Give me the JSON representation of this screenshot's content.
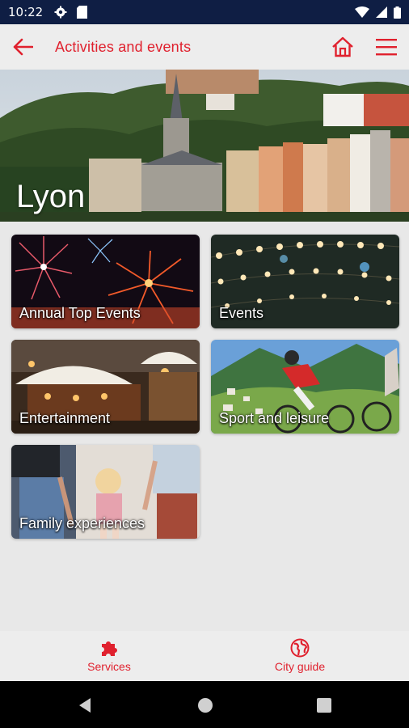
{
  "status_bar": {
    "time": "10:22"
  },
  "app_bar": {
    "title": "Activities and events"
  },
  "hero": {
    "city": "Lyon"
  },
  "categories": [
    {
      "label": "Annual Top Events"
    },
    {
      "label": "Events"
    },
    {
      "label": "Entertainment"
    },
    {
      "label": "Sport and leisure"
    },
    {
      "label": "Family experiences"
    }
  ],
  "bottom_nav": {
    "services": "Services",
    "city_guide": "City guide"
  },
  "colors": {
    "accent": "#e0212e",
    "status_bar": "#0f1e44"
  }
}
